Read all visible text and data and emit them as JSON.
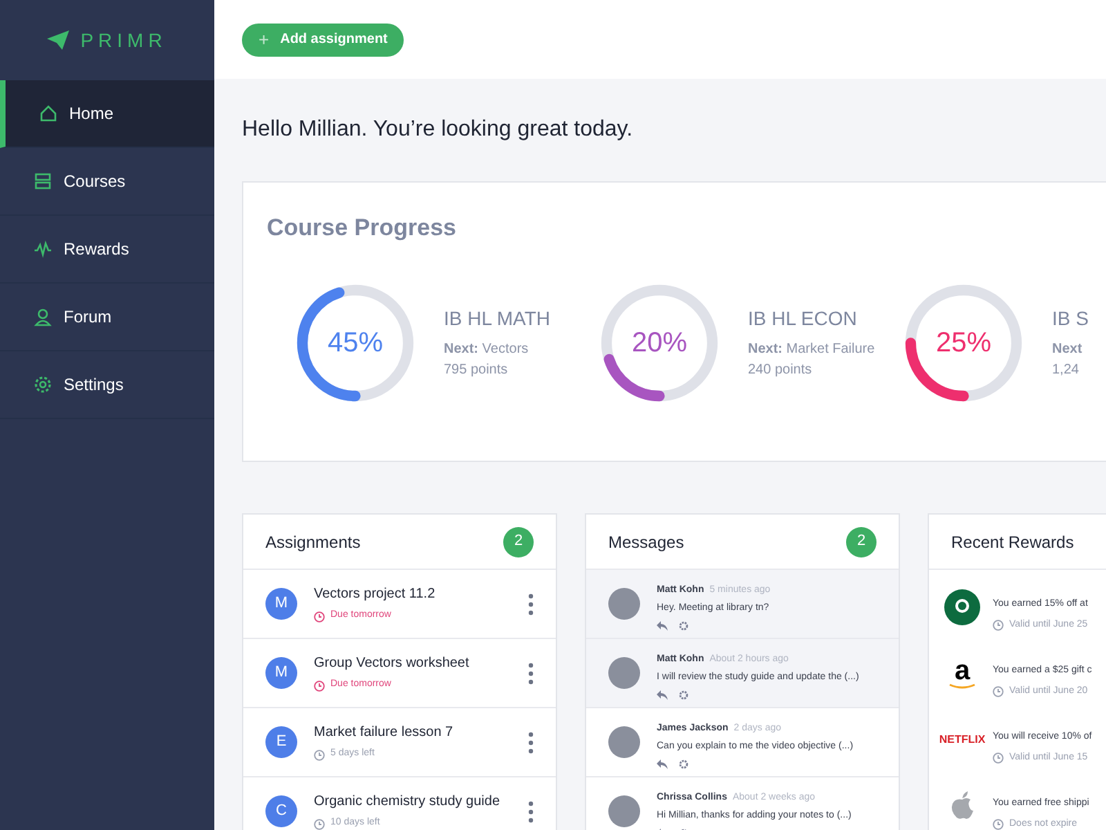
{
  "sidebar": {
    "logo": "PRIMR",
    "items": [
      {
        "label": "Home",
        "selected": true
      },
      {
        "label": "Courses",
        "selected": false
      },
      {
        "label": "Rewards",
        "selected": false
      },
      {
        "label": "Forum",
        "selected": false
      },
      {
        "label": "Settings",
        "selected": false
      }
    ]
  },
  "header": {
    "button": "Add assignment",
    "button_icon": "+"
  },
  "greeting": "Hello Millian. You’re looking great today.",
  "progress": {
    "title": "Course Progress",
    "courses": [
      {
        "percent": "45%",
        "level": 0.45,
        "color": "#4e82ee",
        "name": "IB HL MATH",
        "next_label": "Next:",
        "next": "Vectors",
        "points": "795 points"
      },
      {
        "percent": "20%",
        "level": 0.2,
        "color": "#a855c0",
        "name": "IB HL ECON",
        "next_label": "Next:",
        "next": "Market Failure",
        "points": "240 points"
      },
      {
        "percent": "25%",
        "level": 0.25,
        "color": "#ee2f6e",
        "name": "IB S",
        "next_label": "Next",
        "points": "1,24"
      }
    ]
  },
  "assignments": {
    "title": "Assignments",
    "count": "2",
    "items": [
      {
        "letter": "M",
        "title": "Vectors project 11.2",
        "due": "Due tomorrow",
        "urgent": true
      },
      {
        "letter": "M",
        "title": "Group Vectors worksheet",
        "due": "Due tomorrow",
        "urgent": true
      },
      {
        "letter": "E",
        "title": "Market failure lesson 7",
        "due": "5 days left",
        "urgent": false
      },
      {
        "letter": "C",
        "title": "Organic chemistry study guide",
        "due": "10 days left",
        "urgent": false
      }
    ]
  },
  "messages": {
    "title": "Messages",
    "count": "2",
    "items": [
      {
        "name": "Matt Kohn",
        "time": "5 minutes ago",
        "text": "Hey. Meeting at library tn?",
        "unread": true
      },
      {
        "name": "Matt Kohn",
        "time": "About 2 hours ago",
        "text": "I will review the study guide and update the (...)",
        "unread": true
      },
      {
        "name": "James Jackson",
        "time": "2 days ago",
        "text": "Can you explain to me the video objective (...)",
        "unread": false
      },
      {
        "name": "Chrissa Collins",
        "time": "About 2 weeks ago",
        "text": "Hi Millian, thanks for adding your notes to (...)",
        "unread": false
      }
    ]
  },
  "rewards": {
    "title": "Recent Rewards",
    "items": [
      {
        "kind": "siren",
        "text": "You earned 15% off at",
        "valid": "Valid until June 25"
      },
      {
        "kind": "letter",
        "logo_text": "a",
        "text": "You earned a $25 gift c",
        "valid": "Valid until June 20"
      },
      {
        "kind": "wordmark",
        "logo_text": "NETFLIX",
        "text": "You will receive 10% of",
        "valid": "Valid until June 15"
      },
      {
        "kind": "apple",
        "text": "You earned free shippi",
        "valid": "Does not expire"
      }
    ]
  }
}
